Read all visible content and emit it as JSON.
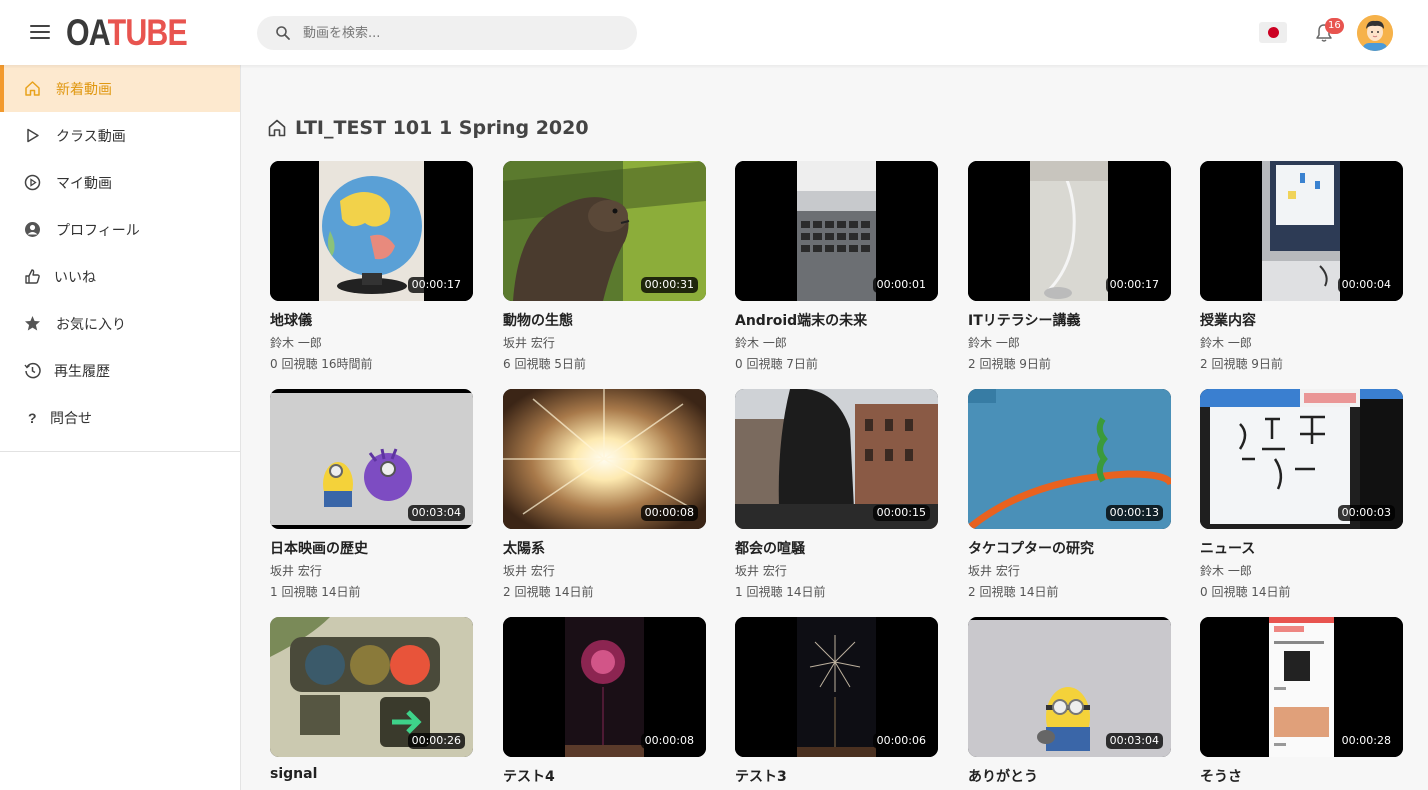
{
  "header": {
    "logo_left": "OA",
    "logo_right": "TUBE",
    "search_placeholder": "動画を検索...",
    "notification_count": "16",
    "flag_color": "#cc0022"
  },
  "sidebar": {
    "items": [
      {
        "label": "新着動画",
        "icon": "home-icon"
      },
      {
        "label": "クラス動画",
        "icon": "play-outline-icon"
      },
      {
        "label": "マイ動画",
        "icon": "play-circle-icon"
      },
      {
        "label": "プロフィール",
        "icon": "user-circle-icon"
      },
      {
        "label": "いいね",
        "icon": "thumbs-up-icon"
      },
      {
        "label": "お気に入り",
        "icon": "star-icon"
      },
      {
        "label": "再生履歴",
        "icon": "history-icon"
      },
      {
        "label": "問合せ",
        "icon": "question-icon"
      }
    ]
  },
  "main": {
    "heading": "LTI_TEST 101 1 Spring 2020",
    "videos": [
      {
        "title": "地球儀",
        "author": "鈴木 一郎",
        "meta": "0 回視聴 16時間前",
        "duration": "00:00:17"
      },
      {
        "title": "動物の生態",
        "author": "坂井 宏行",
        "meta": "6 回視聴 5日前",
        "duration": "00:00:31"
      },
      {
        "title": "Android端末の未来",
        "author": "鈴木 一郎",
        "meta": "0 回視聴 7日前",
        "duration": "00:00:01"
      },
      {
        "title": "ITリテラシー講義",
        "author": "鈴木 一郎",
        "meta": "2 回視聴 9日前",
        "duration": "00:00:17"
      },
      {
        "title": "授業内容",
        "author": "鈴木 一郎",
        "meta": "2 回視聴 9日前",
        "duration": "00:00:04"
      },
      {
        "title": "日本映画の歴史",
        "author": "坂井 宏行",
        "meta": "1 回視聴 14日前",
        "duration": "00:03:04"
      },
      {
        "title": "太陽系",
        "author": "坂井 宏行",
        "meta": "2 回視聴 14日前",
        "duration": "00:00:08"
      },
      {
        "title": "都会の喧騒",
        "author": "坂井 宏行",
        "meta": "1 回視聴 14日前",
        "duration": "00:00:15"
      },
      {
        "title": "タケコプターの研究",
        "author": "坂井 宏行",
        "meta": "2 回視聴 14日前",
        "duration": "00:00:13"
      },
      {
        "title": "ニュース",
        "author": "鈴木 一郎",
        "meta": "0 回視聴 14日前",
        "duration": "00:00:03"
      },
      {
        "title": "signal",
        "author": "",
        "meta": "",
        "duration": "00:00:26"
      },
      {
        "title": "テスト4",
        "author": "",
        "meta": "",
        "duration": "00:00:08"
      },
      {
        "title": "テスト3",
        "author": "",
        "meta": "",
        "duration": "00:00:06"
      },
      {
        "title": "ありがとう",
        "author": "",
        "meta": "",
        "duration": "00:03:04"
      },
      {
        "title": "そうさ",
        "author": "",
        "meta": "",
        "duration": "00:00:28"
      }
    ]
  }
}
